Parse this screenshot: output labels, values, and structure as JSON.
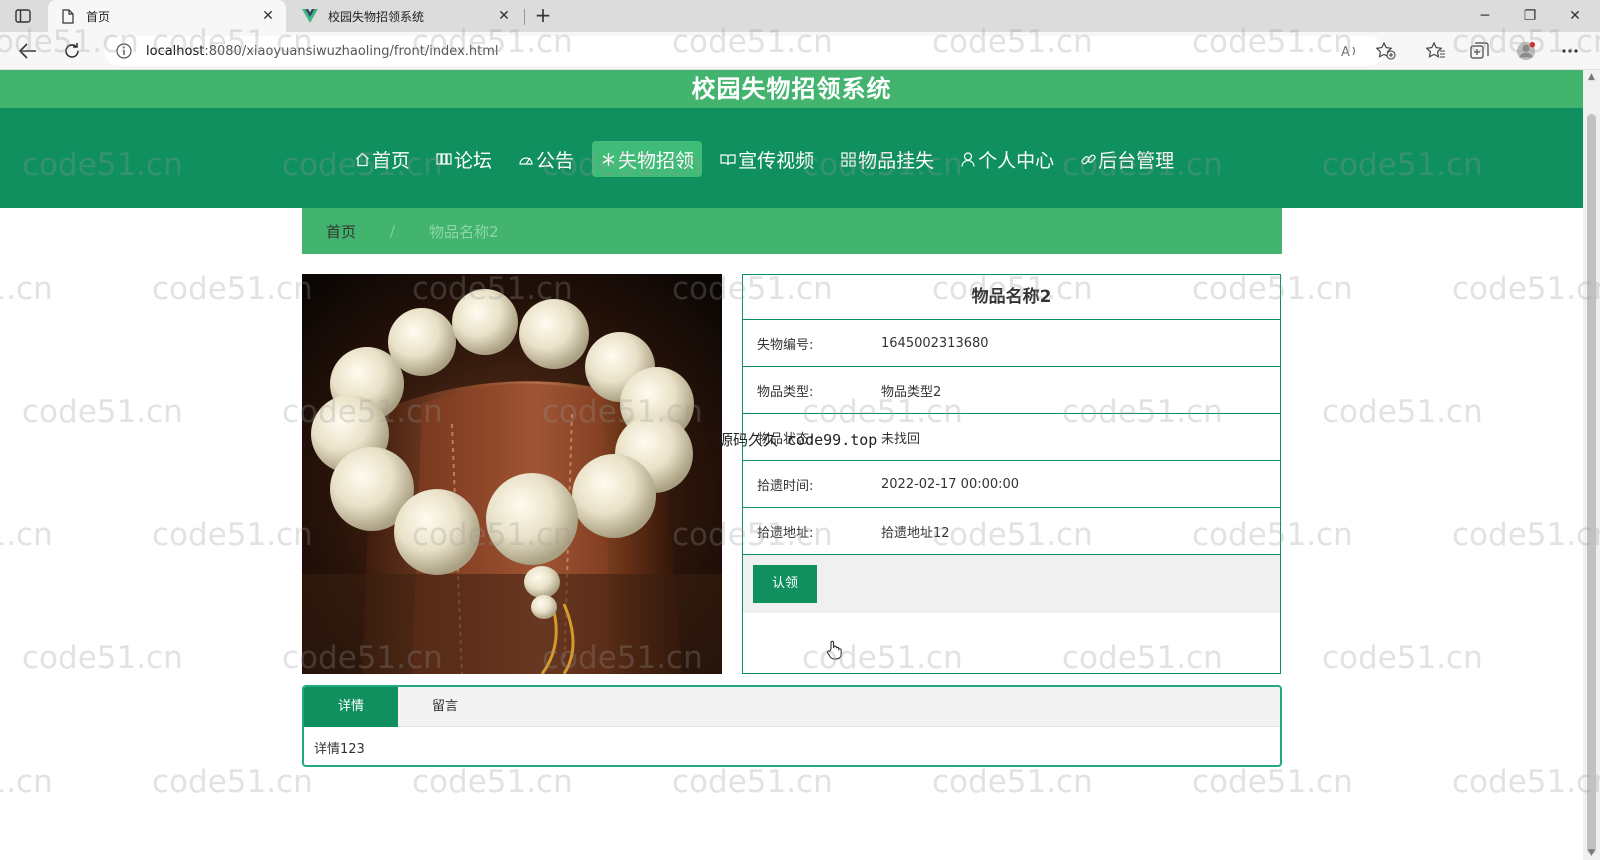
{
  "browser": {
    "tabs": [
      {
        "title": "首页",
        "icon": "page-icon"
      },
      {
        "title": "校园失物招领系统",
        "icon": "vue-logo-icon"
      }
    ],
    "url_host": "localhost",
    "url_rest": ":8080/xiaoyuansiwuzhaoling/front/index.html"
  },
  "site": {
    "title": "校园失物招领系统",
    "nav": [
      {
        "label": "首页",
        "icon": "home-icon",
        "active": false
      },
      {
        "label": "论坛",
        "icon": "forum-icon",
        "active": false
      },
      {
        "label": "公告",
        "icon": "notice-icon",
        "active": false
      },
      {
        "label": "失物招领",
        "icon": "snowflake-icon",
        "active": true
      },
      {
        "label": "宣传视频",
        "icon": "book-icon",
        "active": false
      },
      {
        "label": "物品挂失",
        "icon": "grid-icon",
        "active": false
      },
      {
        "label": "个人中心",
        "icon": "user-icon",
        "active": false
      },
      {
        "label": "后台管理",
        "icon": "link-icon",
        "active": false
      }
    ]
  },
  "breadcrumb": {
    "home": "首页",
    "separator": "/",
    "current": "物品名称2"
  },
  "item": {
    "name": "物品名称2",
    "fields": [
      {
        "label": "失物编号:",
        "value": "1645002313680"
      },
      {
        "label": "物品类型:",
        "value": "物品类型2"
      },
      {
        "label": "物品状态:",
        "value": "未找回"
      },
      {
        "label": "拾遗时间:",
        "value": "2022-02-17 00:00:00"
      },
      {
        "label": "拾遗地址:",
        "value": "拾遗地址12"
      }
    ],
    "claim_button": "认领"
  },
  "overlay_watermark": "源码久久 code99.top",
  "detail_tabs": {
    "tabs": [
      "详情",
      "留言"
    ],
    "active": 0,
    "content": "详情123"
  },
  "watermark_text": "code51.cn",
  "colors": {
    "header_green": "#42b46e",
    "nav_green": "#10905f",
    "active_nav": "#3fbd78"
  }
}
